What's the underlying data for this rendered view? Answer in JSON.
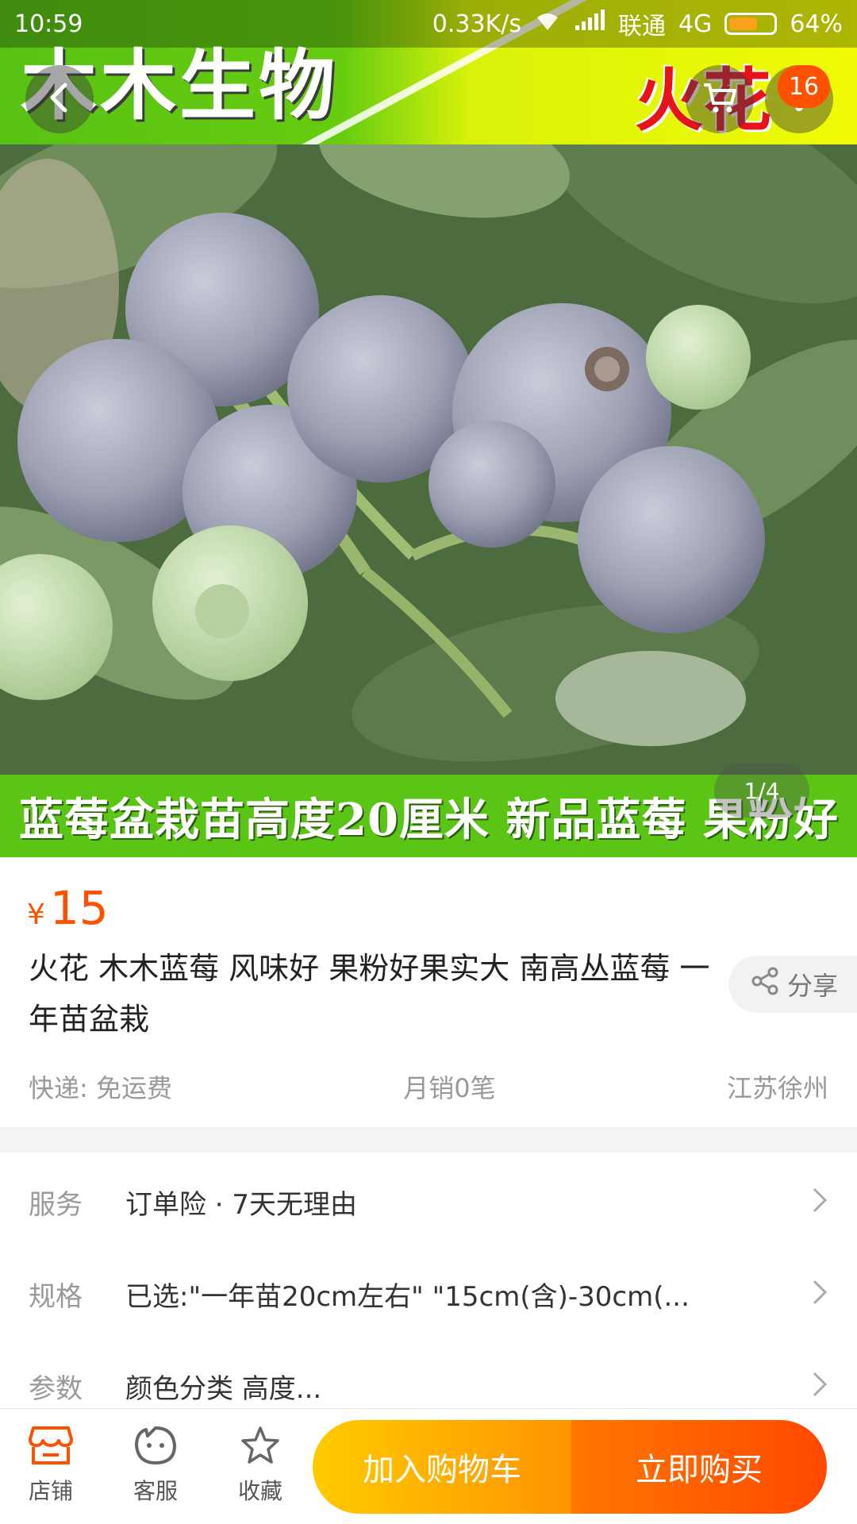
{
  "status_bar": {
    "time": "10:59",
    "net_speed": "0.33K/s",
    "carrier": "联通",
    "network": "4G",
    "battery": "64%",
    "battery_level": 0.64
  },
  "hero": {
    "banner_top_title": "木木生物",
    "banner_top_brand": "火花",
    "banner_bottom_text": "蓝莓盆栽苗高度20厘米  新品蓝莓  果粉好",
    "image_counter": "1/4",
    "cart_count": "16",
    "icons": {
      "back": "back-arrow-icon",
      "cart": "cart-icon",
      "more": "more-dots-icon"
    }
  },
  "product": {
    "currency": "¥",
    "price": "15",
    "title": "火花  木木蓝莓  风味好  果粉好果实大  南高丛蓝莓  一年苗盆栽",
    "share_label": "分享",
    "shipping": "快递: 免运费",
    "monthly_sales": "月销0笔",
    "location": "江苏徐州"
  },
  "rows": {
    "service": {
      "label": "服务",
      "value": "订单险  ·  7天无理由"
    },
    "spec": {
      "label": "规格",
      "value": "已选:\"一年苗20cm左右\" \"15cm(含)-30cm(..."
    },
    "param": {
      "label": "参数",
      "value": "颜色分类 高度..."
    }
  },
  "bottom_bar": {
    "shop": "店铺",
    "customer_service": "客服",
    "favorite": "收藏",
    "add_to_cart": "加入购物车",
    "buy_now": "立即购买"
  },
  "colors": {
    "accent": "#ff5000",
    "cart_button": "#ffb300",
    "buy_button": "#ff5a00",
    "banner_green": "#5bc516",
    "banner_yellow": "#e8f80a"
  }
}
